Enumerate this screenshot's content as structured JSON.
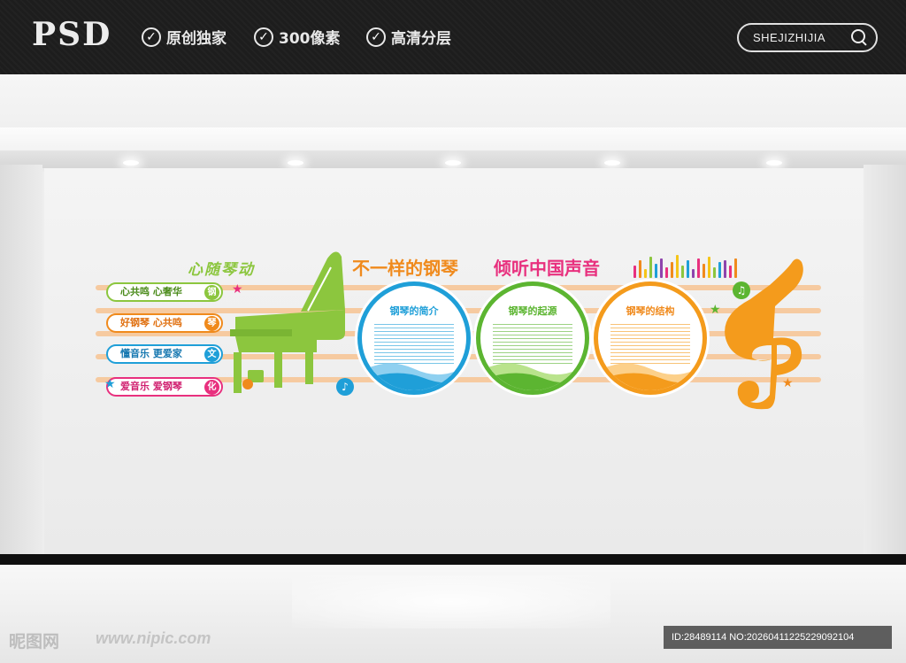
{
  "header": {
    "brand": "PSD",
    "features": [
      "原创独家",
      "300像素",
      "高清分层"
    ],
    "search_text": "SHEJIZHIJIA"
  },
  "mural": {
    "left_heading": "心随琴动",
    "heading_a": "不一样的钢琴",
    "heading_b": "倾听中国声音",
    "slogans": [
      {
        "text": "心共鸣 心奢华",
        "badge": "钢",
        "color": "#8cc63e"
      },
      {
        "text": "好钢琴 心共鸣",
        "badge": "琴",
        "color": "#f08a1c"
      },
      {
        "text": "懂音乐 更爱家",
        "badge": "文",
        "color": "#1f9fd8"
      },
      {
        "text": "爱音乐 爱钢琴",
        "badge": "化",
        "color": "#e8307e"
      }
    ],
    "circles": [
      {
        "title": "钢琴的简介",
        "color": "#1f9fd8"
      },
      {
        "title": "钢琴的起源",
        "color": "#5cb531"
      },
      {
        "title": "钢琴的结构",
        "color": "#f49b1c"
      }
    ],
    "colors": {
      "green": "#8cc63e",
      "orange": "#f08a1c",
      "blue": "#1f9fd8",
      "pink": "#e8307e",
      "staff": "#f6caa0"
    }
  },
  "footer": {
    "watermark": "昵图网",
    "watermark_url": "www.nipic.com",
    "id_text": "ID:28489114 NO:20260411225229092104"
  }
}
